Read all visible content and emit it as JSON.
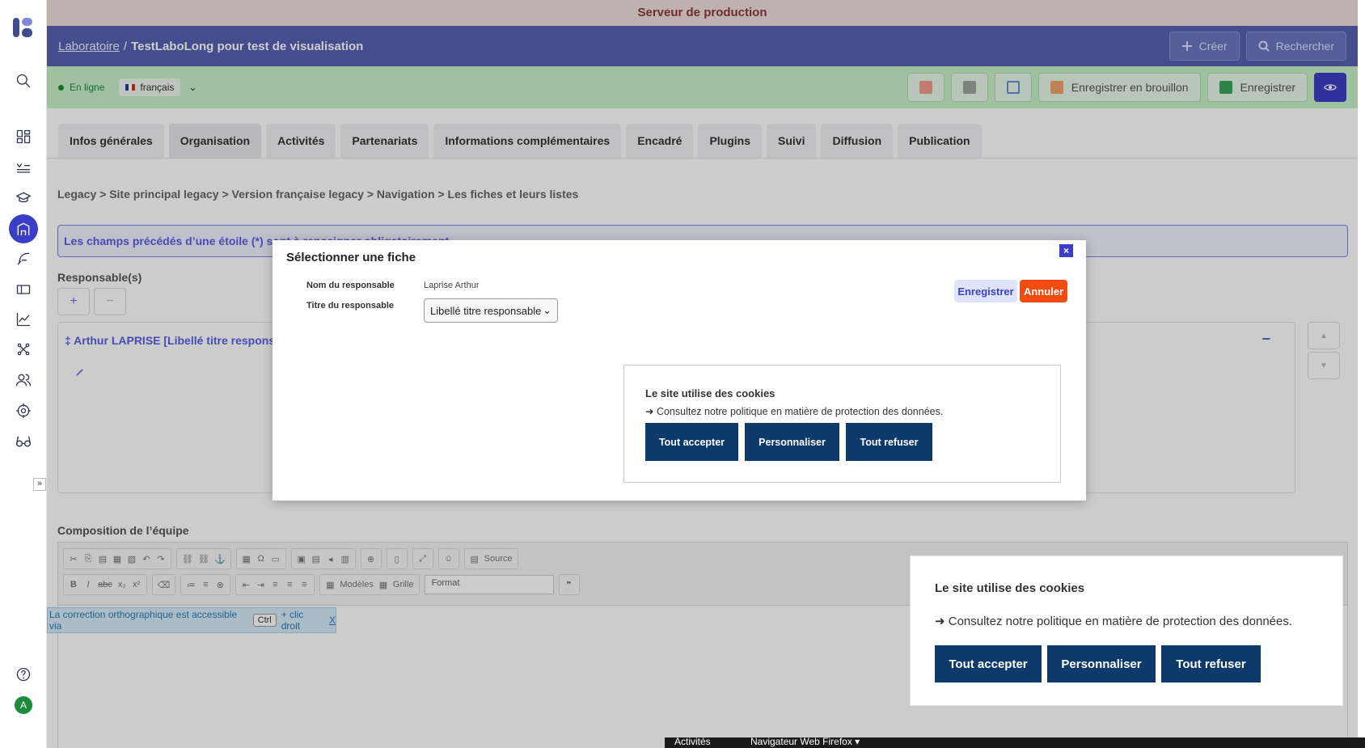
{
  "banner": "Serveur de production",
  "header": {
    "crumb_root": "Laboratoire",
    "separator": "/",
    "title": "TestLaboLong pour test de visualisation",
    "create_label": "Créer",
    "search_label": "Rechercher"
  },
  "toolbar": {
    "status": "En ligne",
    "language": "français",
    "draft_label": "Enregistrer en brouillon",
    "save_label": "Enregistrer"
  },
  "tabs": [
    "Infos générales",
    "Organisation",
    "Activités",
    "Partenariats",
    "Informations complémentaires",
    "Encadré",
    "Plugins",
    "Suivi",
    "Diffusion",
    "Publication"
  ],
  "breadcrumb": "Legacy > Site principal legacy > Version française legacy > Navigation > Les fiches et leurs listes",
  "required_note": "Les champs précédés d’une étoile (*) sont à renseigner obligatoirement",
  "responsables": {
    "label": "Responsable(s)",
    "add": "+",
    "remove": "−",
    "entry": "‡ Arthur LAPRISE [Libellé titre responsable]",
    "collapse": "−"
  },
  "composition_label": "Composition de l’équipe",
  "editor": {
    "source_label": "Source",
    "models_label": "Modèles",
    "grid_label": "Grille",
    "format_label": "Format"
  },
  "spell_note": {
    "before": "La correction orthographique est accessible via",
    "key": "Ctrl",
    "after": "+ clic droit",
    "close": "X"
  },
  "modal": {
    "title": "Sélectionner une fiche",
    "close": "×",
    "name_label": "Nom du responsable",
    "name_value": "Laprise Arthur",
    "title_label": "Titre du responsable",
    "title_value": "Libellé titre responsable",
    "save": "Enregistrer",
    "cancel": "Annuler"
  },
  "cookie": {
    "title": "Le site utilise des cookies",
    "policy": "➜ Consultez notre politique en matière de protection des données.",
    "accept": "Tout accepter",
    "customize": "Personnaliser",
    "refuse": "Tout refuser"
  },
  "taskbar": {
    "activities": "Activités",
    "browser": "Navigateur Web Firefox ▾"
  },
  "rail": {
    "avatar_letter": "A",
    "expand": "»"
  },
  "colors": {
    "accent": "#3b3fc7",
    "header": "#5662b2",
    "toolbar": "#c7f2c9",
    "cookie_button": "#0e3a6b",
    "cancel": "#f24b0f"
  }
}
